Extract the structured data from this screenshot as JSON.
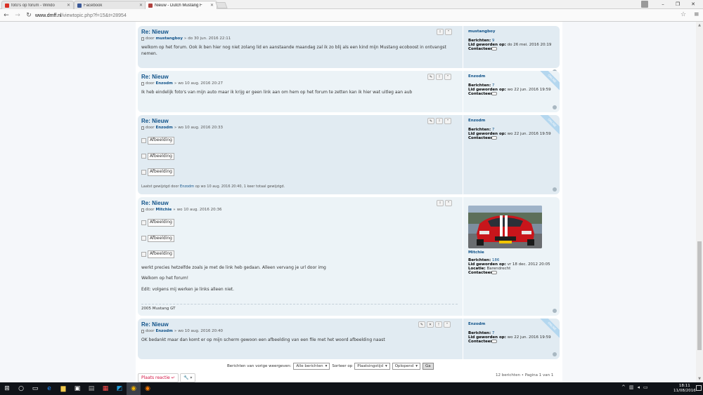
{
  "browser": {
    "tabs": [
      {
        "label": "foto's op forum - Windo",
        "color": "#d93025"
      },
      {
        "label": "Facebook",
        "color": "#3b5998"
      },
      {
        "label": "Nieuw - Dutch Mustang F",
        "color": "#b0413e"
      }
    ],
    "url_host": "www.dmff.nl",
    "url_path": "/viewtopic.php?f=15&t=28954"
  },
  "labels": {
    "by": "door",
    "sep": "»",
    "posts": "Berichten:",
    "joined": "Lid geworden op:",
    "contact": "Contacteer:",
    "location": "Locatie:",
    "image_alt": "Afbeelding",
    "online": "ONLINE"
  },
  "posts": [
    {
      "title": "Re: Nieuw",
      "author": "mustangboy",
      "date": "do 30 jun. 2016 22:11",
      "body": "welkom op het forum. Ook ik ben hier nog niet zolang lid en aanstaande maandag zal ik zo blij als een kind mijn Mustang ecoboost in ontvangst nemen.",
      "profile_name": "mustangboy",
      "posts_count": "9",
      "joined": "do 26 mei. 2016 20:19"
    },
    {
      "title": "Re: Nieuw",
      "author": "Enzodm",
      "date": "wo 10 aug. 2016 20:27",
      "body": "Ik heb eindelijk foto's van mijn auto maar ik krijg er geen link aan om hem op het forum te zetten kan ik hier wat uitleg aan aub",
      "profile_name": "Enzodm",
      "posts_count": "7",
      "joined": "wo 22 jun. 2016 19:59"
    },
    {
      "title": "Re: Nieuw",
      "author": "Enzodm",
      "date": "wo 10 aug. 2016 20:33",
      "edit_prefix": "Laatst gewijzigd door",
      "edit_user": "Enzodm",
      "edit_mid": "op",
      "edit_date": "wo 10 aug. 2016 20:40",
      "edit_suffix": ", 1 keer totaal gewijzigd.",
      "profile_name": "Enzodm",
      "posts_count": "7",
      "joined": "wo 22 jun. 2016 19:59"
    },
    {
      "title": "Re: Nieuw",
      "author": "Mitchie",
      "date": "wo 10 aug. 2016 20:36",
      "line1": "werkt precies hetzelfde zoals je met de link heb gedaan. Alleen vervang je url door img",
      "line2": "Welkom op het forum!",
      "line3": "Edit: volgens mij werken je links alleen niet.",
      "signature": "2005 Mustang GT",
      "profile_name": "Mitchie",
      "posts_count": "186",
      "joined": "vr 18 dec. 2012 20:05",
      "location": "Barendrecht"
    },
    {
      "title": "Re: Nieuw",
      "author": "Enzodm",
      "date": "wo 10 aug. 2016 20:40",
      "body": "OK bedankt maar dan komt er op mijn scherm gewoon een afbeelding van een file met het woord afbeelding naast",
      "profile_name": "Enzodm",
      "posts_count": "7",
      "joined": "wo 22 jun. 2016 19:59"
    }
  ],
  "footer": {
    "show_label": "Berichten van vorige weergeven:",
    "show_value": "Alle berichten",
    "sort_label": "Sorteer op",
    "sort_value": "Plaatsingstijd",
    "order_value": "Oplopend",
    "go": "Ga",
    "reply": "Plaats reactie",
    "pagination": "12 berichten • Pagina 1 van 1"
  },
  "taskbar": {
    "time": "18:11",
    "date": "11/08/2016"
  }
}
